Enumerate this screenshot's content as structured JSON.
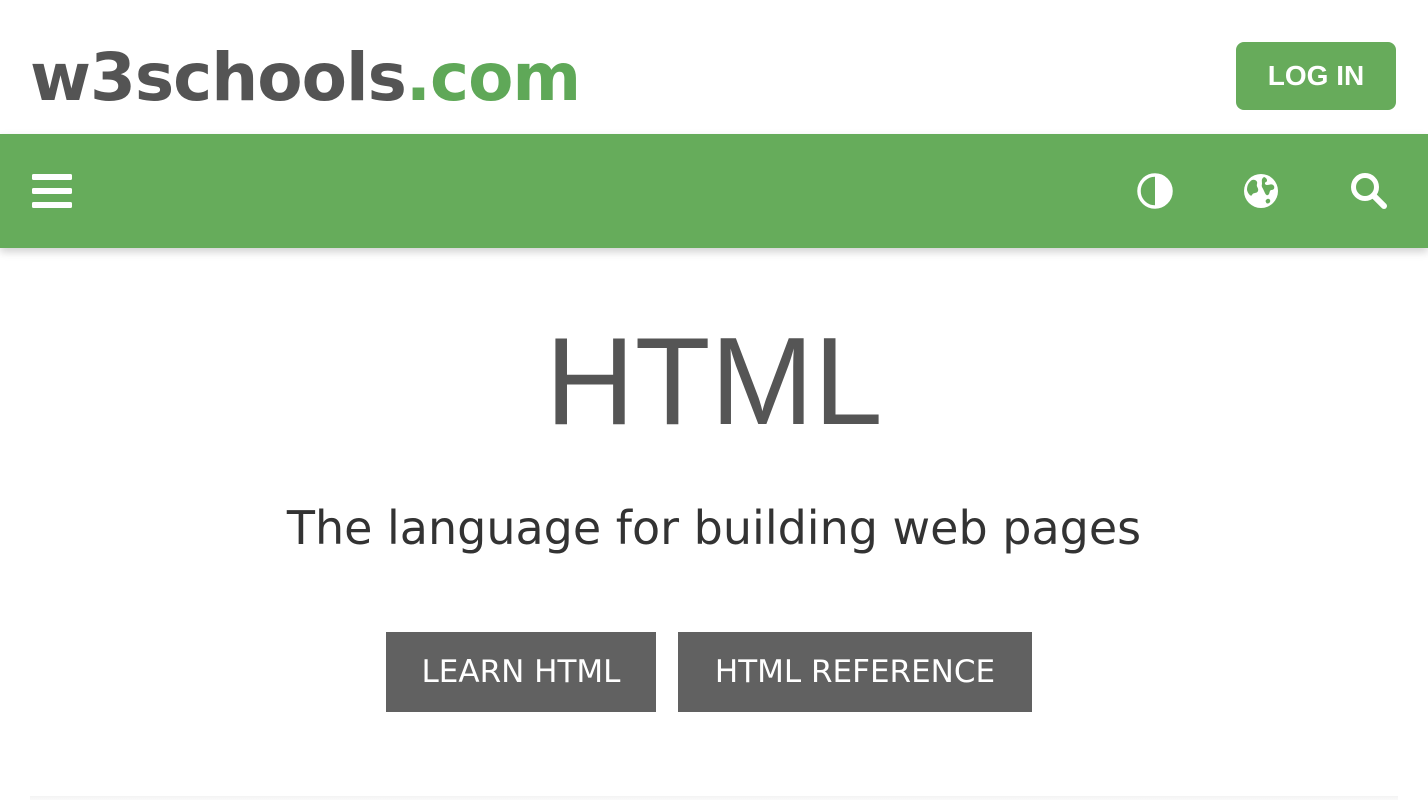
{
  "header": {
    "logo_name": "w3schools",
    "logo_tld": ".com",
    "login_label": "LOG IN"
  },
  "navbar": {
    "icons": [
      "menu-icon",
      "contrast-icon",
      "globe-icon",
      "search-icon"
    ]
  },
  "hero": {
    "title": "HTML",
    "subtitle": "The language for building web pages",
    "learn_label": "LEARN HTML",
    "reference_label": "HTML REFERENCE"
  },
  "colors": {
    "brand_green": "#67ab5b",
    "logo_gray": "#545454",
    "button_gray": "#616161"
  }
}
